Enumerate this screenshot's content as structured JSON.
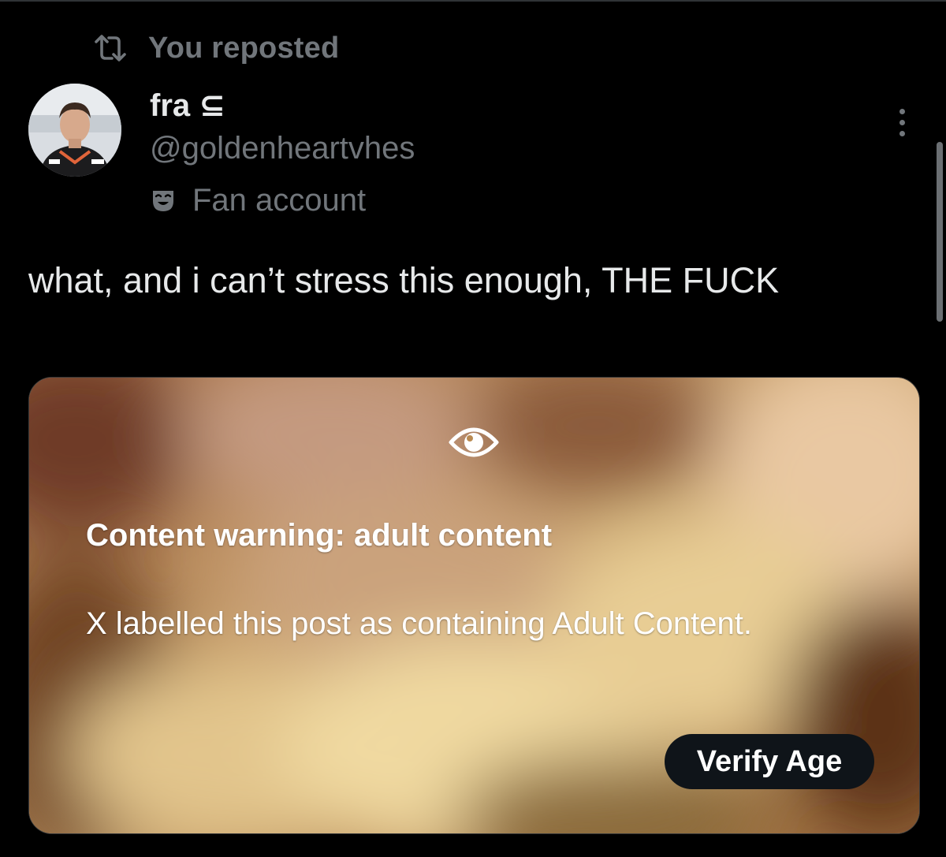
{
  "repost": {
    "icon": "repost-icon",
    "label": "You reposted"
  },
  "author": {
    "display_name": "fra ⊆",
    "handle": "@goldenheartvhes",
    "label_icon": "theater-mask-icon",
    "label": "Fan account",
    "avatar": "avatar"
  },
  "menu": {
    "icon": "more-vertical-icon"
  },
  "post": {
    "text": "what, and i can’t stress this enough, THE FUCK"
  },
  "media": {
    "icon": "eye-icon",
    "warning_title": "Content warning: adult content",
    "warning_body": "X labelled this post as containing Adult Content.",
    "verify_button": "Verify Age"
  },
  "colors": {
    "background": "#000000",
    "primary_text": "#e7e9ea",
    "secondary_text": "#71767b",
    "button_bg": "#0f1419"
  }
}
